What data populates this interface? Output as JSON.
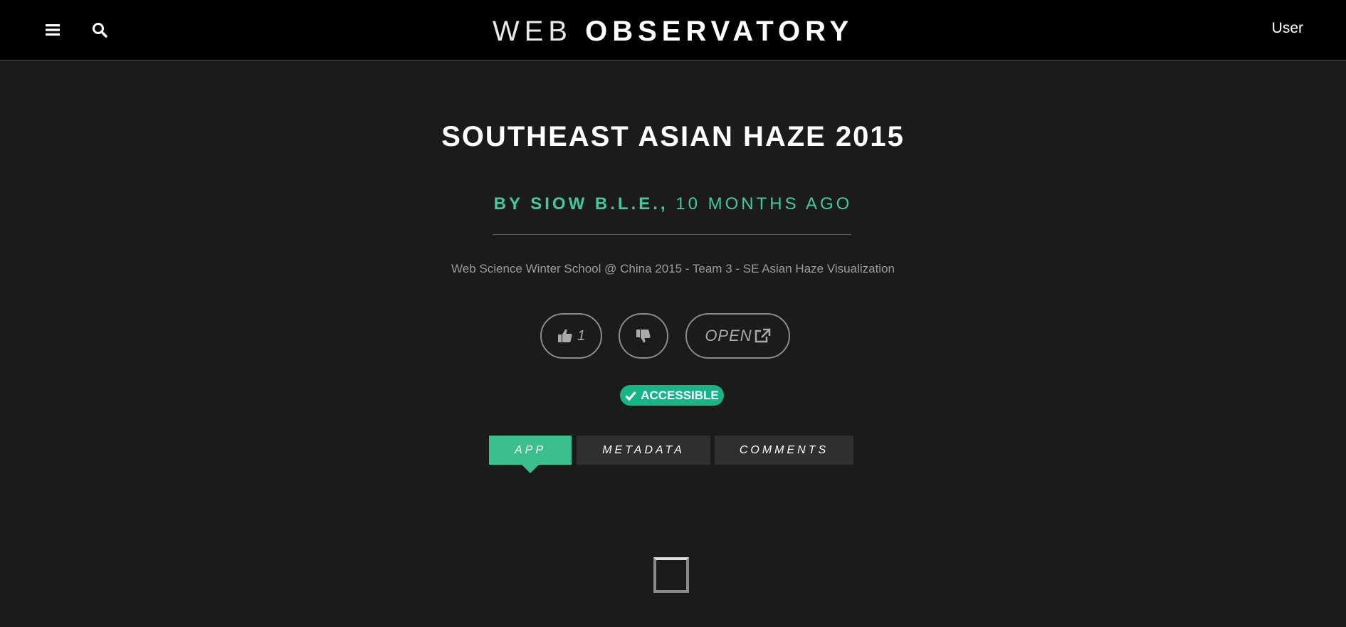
{
  "header": {
    "brand_light": "WEB",
    "brand_bold": "OBSERVATORY",
    "user_label": "User"
  },
  "page": {
    "title": "SOUTHEAST ASIAN HAZE 2015",
    "by_prefix": "BY",
    "author": "SIOW B.L.E.,",
    "time": "10 MONTHS AGO",
    "description": "Web Science Winter School @ China 2015 - Team 3 - SE Asian Haze Visualization"
  },
  "actions": {
    "like_count": "1",
    "open_label": "OPEN"
  },
  "badge": {
    "label": "ACCESSIBLE"
  },
  "tabs": [
    {
      "label": "APP",
      "active": true
    },
    {
      "label": "METADATA",
      "active": false
    },
    {
      "label": "COMMENTS",
      "active": false
    }
  ],
  "colors": {
    "accent": "#3bbf8e",
    "badge": "#17b487",
    "background": "#1b1b1b"
  },
  "icons": [
    "menu-icon",
    "search-icon",
    "thumbs-up-icon",
    "thumbs-down-icon",
    "external-link-icon",
    "check-icon",
    "loading-spinner-icon"
  ]
}
